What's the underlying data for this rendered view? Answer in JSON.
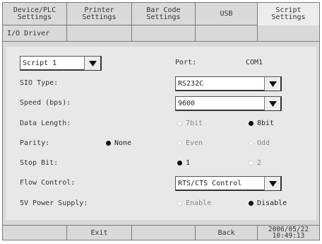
{
  "tabs": [
    "Device/PLC\nSettings",
    "Printer\nSettings",
    "Bar Code\nSettings",
    "USB",
    "Script\nSettings"
  ],
  "subtabs": [
    "I/O Driver",
    "",
    "",
    "",
    ""
  ],
  "script_select": {
    "value": "Script 1"
  },
  "port": {
    "label": "Port:",
    "value": "COM1"
  },
  "sio_type": {
    "label": "SIO Type:",
    "value": "RS232C"
  },
  "speed": {
    "label": "Speed (bps):",
    "value": "9600"
  },
  "data_length": {
    "label": "Data Length:",
    "options": [
      "7bit",
      "8bit"
    ],
    "selected": "8bit"
  },
  "parity": {
    "label": "Parity:",
    "options": [
      "None",
      "Even",
      "Odd"
    ],
    "selected": "None"
  },
  "stop_bit": {
    "label": "Stop Bit:",
    "options": [
      "1",
      "2"
    ],
    "selected": "1"
  },
  "flow_control": {
    "label": "Flow Control:",
    "value": "RTS/CTS Control"
  },
  "power_supply": {
    "label": "5V Power Supply:",
    "options": [
      "Enable",
      "Disable"
    ],
    "selected": "Disable"
  },
  "bottom": {
    "exit_label": "Exit",
    "back_label": "Back",
    "date": "2006/05/22",
    "time": "10:49:13"
  }
}
